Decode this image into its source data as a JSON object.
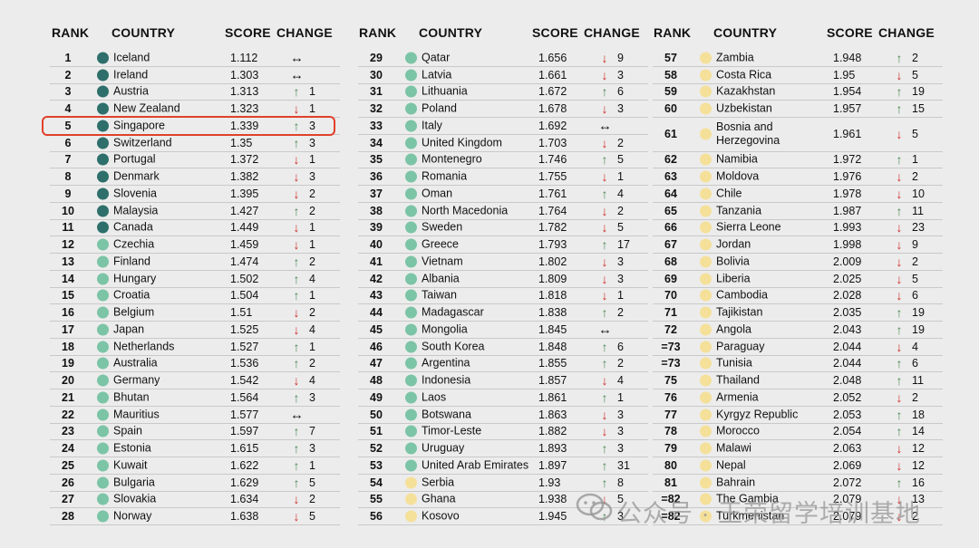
{
  "headers": {
    "rank": "RANK",
    "country": "COUNTRY",
    "score": "SCORE",
    "change": "CHANGE"
  },
  "colors": {
    "tier1": "#2e6f6b",
    "tier2": "#7cc4a6",
    "tier3": "#f5e09a",
    "up": "#4e8b58",
    "down": "#cf2e2a",
    "highlight": "#e0412b"
  },
  "icons": {
    "up": "up-arrow-icon",
    "down": "down-arrow-icon",
    "same": "no-change-icon"
  },
  "highlighted_rank": "5",
  "watermark": {
    "text": "公众号 · 王荣留学培训基地",
    "icon": "wechat-icon"
  },
  "columns": [
    [
      {
        "rank": "1",
        "country": "Iceland",
        "score": "1.112",
        "dir": "same",
        "change": "",
        "tier": 1
      },
      {
        "rank": "2",
        "country": "Ireland",
        "score": "1.303",
        "dir": "same",
        "change": "",
        "tier": 1
      },
      {
        "rank": "3",
        "country": "Austria",
        "score": "1.313",
        "dir": "up",
        "change": "1",
        "tier": 1
      },
      {
        "rank": "4",
        "country": "New Zealand",
        "score": "1.323",
        "dir": "down",
        "change": "1",
        "tier": 1
      },
      {
        "rank": "5",
        "country": "Singapore",
        "score": "1.339",
        "dir": "up",
        "change": "3",
        "tier": 1
      },
      {
        "rank": "6",
        "country": "Switzerland",
        "score": "1.35",
        "dir": "up",
        "change": "3",
        "tier": 1
      },
      {
        "rank": "7",
        "country": "Portugal",
        "score": "1.372",
        "dir": "down",
        "change": "1",
        "tier": 1
      },
      {
        "rank": "8",
        "country": "Denmark",
        "score": "1.382",
        "dir": "down",
        "change": "3",
        "tier": 1
      },
      {
        "rank": "9",
        "country": "Slovenia",
        "score": "1.395",
        "dir": "down",
        "change": "2",
        "tier": 1
      },
      {
        "rank": "10",
        "country": "Malaysia",
        "score": "1.427",
        "dir": "up",
        "change": "2",
        "tier": 1
      },
      {
        "rank": "11",
        "country": "Canada",
        "score": "1.449",
        "dir": "down",
        "change": "1",
        "tier": 1
      },
      {
        "rank": "12",
        "country": "Czechia",
        "score": "1.459",
        "dir": "down",
        "change": "1",
        "tier": 2
      },
      {
        "rank": "13",
        "country": "Finland",
        "score": "1.474",
        "dir": "up",
        "change": "2",
        "tier": 2
      },
      {
        "rank": "14",
        "country": "Hungary",
        "score": "1.502",
        "dir": "up",
        "change": "4",
        "tier": 2
      },
      {
        "rank": "15",
        "country": "Croatia",
        "score": "1.504",
        "dir": "up",
        "change": "1",
        "tier": 2
      },
      {
        "rank": "16",
        "country": "Belgium",
        "score": "1.51",
        "dir": "down",
        "change": "2",
        "tier": 2
      },
      {
        "rank": "17",
        "country": "Japan",
        "score": "1.525",
        "dir": "down",
        "change": "4",
        "tier": 2
      },
      {
        "rank": "18",
        "country": "Netherlands",
        "score": "1.527",
        "dir": "up",
        "change": "1",
        "tier": 2
      },
      {
        "rank": "19",
        "country": "Australia",
        "score": "1.536",
        "dir": "up",
        "change": "2",
        "tier": 2
      },
      {
        "rank": "20",
        "country": "Germany",
        "score": "1.542",
        "dir": "down",
        "change": "4",
        "tier": 2
      },
      {
        "rank": "21",
        "country": "Bhutan",
        "score": "1.564",
        "dir": "up",
        "change": "3",
        "tier": 2
      },
      {
        "rank": "22",
        "country": "Mauritius",
        "score": "1.577",
        "dir": "same",
        "change": "",
        "tier": 2
      },
      {
        "rank": "23",
        "country": "Spain",
        "score": "1.597",
        "dir": "up",
        "change": "7",
        "tier": 2
      },
      {
        "rank": "24",
        "country": "Estonia",
        "score": "1.615",
        "dir": "up",
        "change": "3",
        "tier": 2
      },
      {
        "rank": "25",
        "country": "Kuwait",
        "score": "1.622",
        "dir": "up",
        "change": "1",
        "tier": 2
      },
      {
        "rank": "26",
        "country": "Bulgaria",
        "score": "1.629",
        "dir": "up",
        "change": "5",
        "tier": 2
      },
      {
        "rank": "27",
        "country": "Slovakia",
        "score": "1.634",
        "dir": "down",
        "change": "2",
        "tier": 2
      },
      {
        "rank": "28",
        "country": "Norway",
        "score": "1.638",
        "dir": "down",
        "change": "5",
        "tier": 2
      }
    ],
    [
      {
        "rank": "29",
        "country": "Qatar",
        "score": "1.656",
        "dir": "down",
        "change": "9",
        "tier": 2
      },
      {
        "rank": "30",
        "country": "Latvia",
        "score": "1.661",
        "dir": "down",
        "change": "3",
        "tier": 2
      },
      {
        "rank": "31",
        "country": "Lithuania",
        "score": "1.672",
        "dir": "up",
        "change": "6",
        "tier": 2
      },
      {
        "rank": "32",
        "country": "Poland",
        "score": "1.678",
        "dir": "down",
        "change": "3",
        "tier": 2
      },
      {
        "rank": "33",
        "country": "Italy",
        "score": "1.692",
        "dir": "same",
        "change": "",
        "tier": 2
      },
      {
        "rank": "34",
        "country": "United Kingdom",
        "score": "1.703",
        "dir": "down",
        "change": "2",
        "tier": 2
      },
      {
        "rank": "35",
        "country": "Montenegro",
        "score": "1.746",
        "dir": "up",
        "change": "5",
        "tier": 2
      },
      {
        "rank": "36",
        "country": "Romania",
        "score": "1.755",
        "dir": "down",
        "change": "1",
        "tier": 2
      },
      {
        "rank": "37",
        "country": "Oman",
        "score": "1.761",
        "dir": "up",
        "change": "4",
        "tier": 2
      },
      {
        "rank": "38",
        "country": "North Macedonia",
        "score": "1.764",
        "dir": "down",
        "change": "2",
        "tier": 2
      },
      {
        "rank": "39",
        "country": "Sweden",
        "score": "1.782",
        "dir": "down",
        "change": "5",
        "tier": 2
      },
      {
        "rank": "40",
        "country": "Greece",
        "score": "1.793",
        "dir": "up",
        "change": "17",
        "tier": 2
      },
      {
        "rank": "41",
        "country": "Vietnam",
        "score": "1.802",
        "dir": "down",
        "change": "3",
        "tier": 2
      },
      {
        "rank": "42",
        "country": "Albania",
        "score": "1.809",
        "dir": "down",
        "change": "3",
        "tier": 2
      },
      {
        "rank": "43",
        "country": "Taiwan",
        "score": "1.818",
        "dir": "down",
        "change": "1",
        "tier": 2
      },
      {
        "rank": "44",
        "country": "Madagascar",
        "score": "1.838",
        "dir": "up",
        "change": "2",
        "tier": 2
      },
      {
        "rank": "45",
        "country": "Mongolia",
        "score": "1.845",
        "dir": "same",
        "change": "",
        "tier": 2
      },
      {
        "rank": "46",
        "country": "South Korea",
        "score": "1.848",
        "dir": "up",
        "change": "6",
        "tier": 2
      },
      {
        "rank": "47",
        "country": "Argentina",
        "score": "1.855",
        "dir": "up",
        "change": "2",
        "tier": 2
      },
      {
        "rank": "48",
        "country": "Indonesia",
        "score": "1.857",
        "dir": "down",
        "change": "4",
        "tier": 2
      },
      {
        "rank": "49",
        "country": "Laos",
        "score": "1.861",
        "dir": "up",
        "change": "1",
        "tier": 2
      },
      {
        "rank": "50",
        "country": "Botswana",
        "score": "1.863",
        "dir": "down",
        "change": "3",
        "tier": 2
      },
      {
        "rank": "51",
        "country": "Timor-Leste",
        "score": "1.882",
        "dir": "down",
        "change": "3",
        "tier": 2
      },
      {
        "rank": "52",
        "country": "Uruguay",
        "score": "1.893",
        "dir": "up",
        "change": "3",
        "tier": 2
      },
      {
        "rank": "53",
        "country": "United Arab Emirates",
        "score": "1.897",
        "dir": "up",
        "change": "31",
        "tier": 2
      },
      {
        "rank": "54",
        "country": "Serbia",
        "score": "1.93",
        "dir": "up",
        "change": "8",
        "tier": 3
      },
      {
        "rank": "55",
        "country": "Ghana",
        "score": "1.938",
        "dir": "down",
        "change": "5",
        "tier": 3
      },
      {
        "rank": "56",
        "country": "Kosovo",
        "score": "1.945",
        "dir": "up",
        "change": "3",
        "tier": 3
      }
    ],
    [
      {
        "rank": "57",
        "country": "Zambia",
        "score": "1.948",
        "dir": "up",
        "change": "2",
        "tier": 3
      },
      {
        "rank": "58",
        "country": "Costa Rica",
        "score": "1.95",
        "dir": "down",
        "change": "5",
        "tier": 3
      },
      {
        "rank": "59",
        "country": "Kazakhstan",
        "score": "1.954",
        "dir": "up",
        "change": "19",
        "tier": 3
      },
      {
        "rank": "60",
        "country": "Uzbekistan",
        "score": "1.957",
        "dir": "up",
        "change": "15",
        "tier": 3
      },
      {
        "rank": "61",
        "country": "Bosnia and Herzegovina",
        "score": "1.961",
        "dir": "down",
        "change": "5",
        "tier": 3,
        "tall": true
      },
      {
        "rank": "62",
        "country": "Namibia",
        "score": "1.972",
        "dir": "up",
        "change": "1",
        "tier": 3
      },
      {
        "rank": "63",
        "country": "Moldova",
        "score": "1.976",
        "dir": "down",
        "change": "2",
        "tier": 3
      },
      {
        "rank": "64",
        "country": "Chile",
        "score": "1.978",
        "dir": "down",
        "change": "10",
        "tier": 3
      },
      {
        "rank": "65",
        "country": "Tanzania",
        "score": "1.987",
        "dir": "up",
        "change": "11",
        "tier": 3
      },
      {
        "rank": "66",
        "country": "Sierra Leone",
        "score": "1.993",
        "dir": "down",
        "change": "23",
        "tier": 3
      },
      {
        "rank": "67",
        "country": "Jordan",
        "score": "1.998",
        "dir": "down",
        "change": "9",
        "tier": 3
      },
      {
        "rank": "68",
        "country": "Bolivia",
        "score": "2.009",
        "dir": "down",
        "change": "2",
        "tier": 3
      },
      {
        "rank": "69",
        "country": "Liberia",
        "score": "2.025",
        "dir": "down",
        "change": "5",
        "tier": 3
      },
      {
        "rank": "70",
        "country": "Cambodia",
        "score": "2.028",
        "dir": "down",
        "change": "6",
        "tier": 3
      },
      {
        "rank": "71",
        "country": "Tajikistan",
        "score": "2.035",
        "dir": "up",
        "change": "19",
        "tier": 3
      },
      {
        "rank": "72",
        "country": "Angola",
        "score": "2.043",
        "dir": "up",
        "change": "19",
        "tier": 3
      },
      {
        "rank": "=73",
        "country": "Paraguay",
        "score": "2.044",
        "dir": "down",
        "change": "4",
        "tier": 3
      },
      {
        "rank": "=73",
        "country": "Tunisia",
        "score": "2.044",
        "dir": "up",
        "change": "6",
        "tier": 3
      },
      {
        "rank": "75",
        "country": "Thailand",
        "score": "2.048",
        "dir": "up",
        "change": "11",
        "tier": 3
      },
      {
        "rank": "76",
        "country": "Armenia",
        "score": "2.052",
        "dir": "down",
        "change": "2",
        "tier": 3
      },
      {
        "rank": "77",
        "country": "Kyrgyz Republic",
        "score": "2.053",
        "dir": "up",
        "change": "18",
        "tier": 3
      },
      {
        "rank": "78",
        "country": "Morocco",
        "score": "2.054",
        "dir": "up",
        "change": "14",
        "tier": 3
      },
      {
        "rank": "79",
        "country": "Malawi",
        "score": "2.063",
        "dir": "down",
        "change": "12",
        "tier": 3
      },
      {
        "rank": "80",
        "country": "Nepal",
        "score": "2.069",
        "dir": "down",
        "change": "12",
        "tier": 3
      },
      {
        "rank": "81",
        "country": "Bahrain",
        "score": "2.072",
        "dir": "up",
        "change": "16",
        "tier": 3
      },
      {
        "rank": "=82",
        "country": "The Gambia",
        "score": "2.079",
        "dir": "down",
        "change": "13",
        "tier": 3
      },
      {
        "rank": "=82",
        "country": "Turkmenistan",
        "score": "2.079",
        "dir": "down",
        "change": "2",
        "tier": 3
      }
    ]
  ]
}
